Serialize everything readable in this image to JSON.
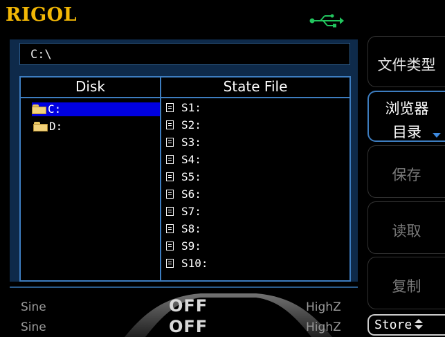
{
  "header": {
    "brand": "RIGOL",
    "usb_icon": "usb-icon"
  },
  "browser": {
    "path": "C:\\",
    "columns": {
      "disk": "Disk",
      "state_file": "State File"
    },
    "disks": [
      {
        "label": "C:",
        "selected": true
      },
      {
        "label": "D:",
        "selected": false
      }
    ],
    "state_files": [
      "S1:",
      "S2:",
      "S3:",
      "S4:",
      "S5:",
      "S6:",
      "S7:",
      "S8:",
      "S9:",
      "S10:"
    ]
  },
  "status": {
    "ch1_wave": "Sine",
    "ch2_wave": "Sine",
    "ch1_output": "OFF",
    "ch2_output": "OFF",
    "ch1_load": "HighZ",
    "ch2_load": "HighZ"
  },
  "softkeys": {
    "file_type": "文件类型",
    "browser_line1": "浏览器",
    "browser_line2": "目录",
    "save": "保存",
    "read": "读取",
    "copy": "复制",
    "store_menu": "Store"
  },
  "colors": {
    "accent": "#3d7dc0",
    "selection": "#0000e0",
    "brand": "#f2b705",
    "usb": "#22c55e"
  }
}
